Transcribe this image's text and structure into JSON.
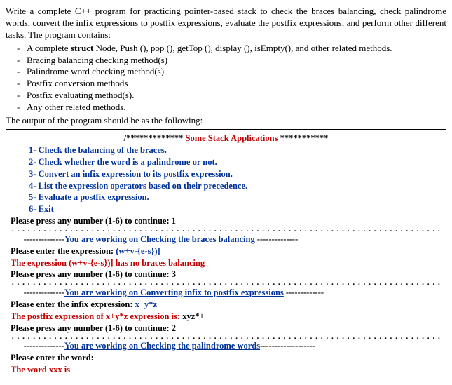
{
  "problem": {
    "intro": "Write a complete C++ program for practicing pointer-based stack to check the braces balancing, check palindrome words, convert the infix expressions to postfix expressions, evaluate the postfix expressions, and perform other different tasks. The program contains:",
    "bullets": [
      "A complete struct Node, Push (), pop (), getTop (), display (), isEmpty(), and other related methods.",
      "Bracing balancing checking method(s)",
      "Palindrome word checking method(s)",
      "Postfix conversion methods",
      "Postfix evaluating method(s).",
      "Any other related methods."
    ],
    "output_intro": "The output of the program should be as the following:"
  },
  "out": {
    "stars_left": "/*************",
    "app_title": " Some Stack Applications ",
    "stars_right": "***********",
    "menu": [
      "1-  Check the balancing of the braces.",
      "2-  Check whether the word is a palindrome or not.",
      "3-  Convert an infix expression to its postfix expression.",
      "4-  List the expression operators based on their precedence.",
      "5-  Evaluate a postfix expression.",
      "6-  Exit"
    ],
    "prompt_label": "Please press any number (1-6) to continue: ",
    "p1": "1",
    "sec1_dashes_l": "--------------",
    "sec1_title": "You are working on Checking the braces balancing",
    "sec1_dashes_r": " --------------",
    "enter_expr_label": "Please enter the expression:  ",
    "expr1": "(w+v-{e-s})]",
    "res1": "The expression (w+v-{e-s})] has no braces balancing",
    "p3": "3",
    "sec3_dashes_l": "--------------",
    "sec3_title": "You are working on Converting infix to postfix expressions",
    "sec3_dashes_r": " -------------",
    "enter_infix_label": "Please enter the infix expression:   ",
    "infix": "x+y*z",
    "res3_a": "The postfix expression of x+y*z expression is:    ",
    "res3_b": "xyz*+",
    "p2": "2",
    "sec2_dashes_l": "--------------",
    "sec2_title": "You are working on Checking the palindrome words",
    "sec2_dashes_r": "-------------------",
    "enter_word": "Please enter the word:",
    "res2": "The word xxx is"
  }
}
